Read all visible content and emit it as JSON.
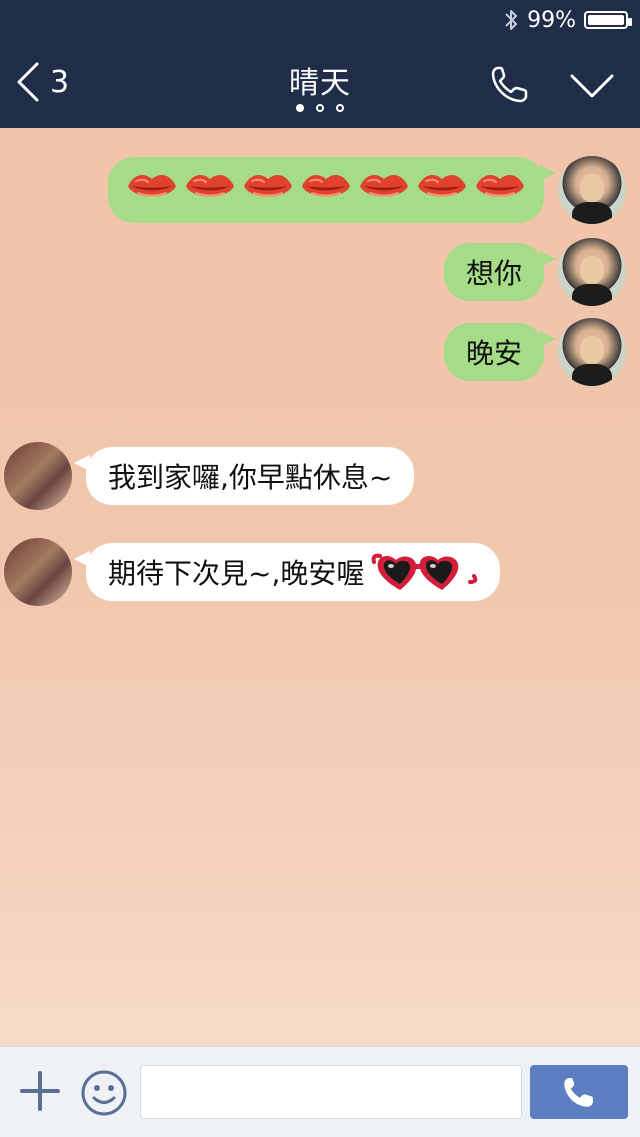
{
  "status_bar": {
    "battery_text": "99%",
    "battery_level": 0.99
  },
  "header": {
    "back_count": "3",
    "title": "晴天",
    "page_dots": 3,
    "active_dot": 0,
    "background": "#1f2d49"
  },
  "messages": [
    {
      "direction": "out",
      "type": "sticker",
      "sticker": "lips-icon",
      "count": 7
    },
    {
      "direction": "out",
      "type": "text",
      "text": "想你"
    },
    {
      "direction": "out",
      "type": "text",
      "text": "晚安"
    },
    {
      "direction": "in",
      "type": "text",
      "text": "我到家囉,你早點休息~"
    },
    {
      "direction": "in",
      "type": "text",
      "text": "期待下次見~,晚安喔",
      "trailing_emoji": "heart-sunglasses-icon"
    }
  ],
  "composer": {
    "input_value": "",
    "input_placeholder": ""
  },
  "colors": {
    "outgoing_bubble": "#a6dc87",
    "incoming_bubble": "#ffffff",
    "chat_background": "#f2c4aa",
    "call_button": "#5d7fc1"
  }
}
